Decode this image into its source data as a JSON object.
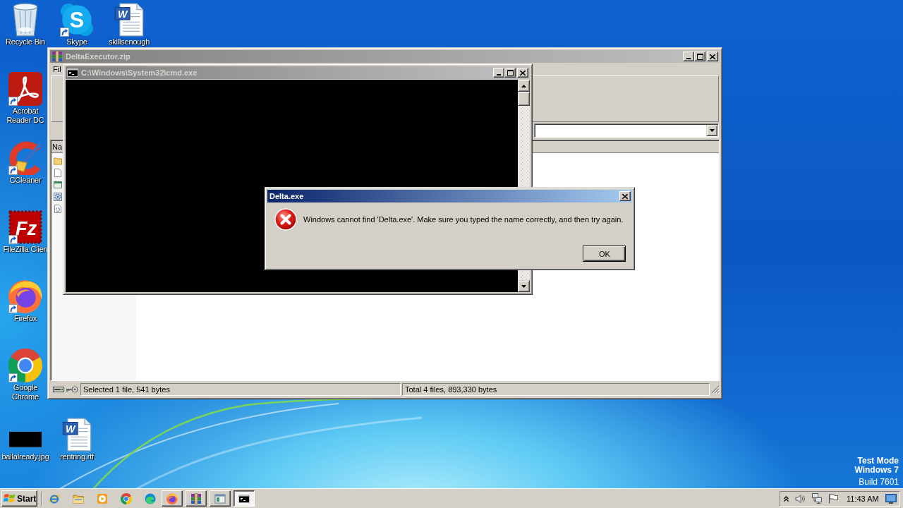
{
  "desktop": {
    "icons": [
      {
        "kind": "recycle-bin",
        "label": "Recycle Bin",
        "shortcut": false
      },
      {
        "kind": "skype",
        "label": "Skype",
        "logo_text": "S",
        "shortcut": true
      },
      {
        "kind": "word-document",
        "label": "skillsenough",
        "logo_text": "W",
        "shortcut": false
      },
      {
        "kind": "acrobat",
        "label": "Acrobat Reader DC",
        "shortcut": true
      },
      {
        "kind": "ccleaner",
        "label": "CCleaner",
        "shortcut": true
      },
      {
        "kind": "filezilla",
        "label": "FileZilla Clien",
        "logo_text": "Fz",
        "shortcut": true
      },
      {
        "kind": "firefox",
        "label": "Firefox",
        "shortcut": true
      },
      {
        "kind": "chrome",
        "label": "Google Chrome",
        "shortcut": true
      },
      {
        "kind": "image",
        "label": "ballalready.jpg",
        "shortcut": false
      },
      {
        "kind": "word-document",
        "label": "rentring.rtf",
        "logo_text": "W",
        "shortcut": false
      }
    ]
  },
  "system_notice": {
    "mode": "Test Mode",
    "edition": "Windows 7",
    "build": "Build 7601"
  },
  "winrar_window": {
    "title": "DeltaExecutor.zip",
    "active": false,
    "menu": [
      "Fil"
    ],
    "column_header": "Na",
    "file_rows": [
      {
        "kind": "folder"
      },
      {
        "kind": "document"
      },
      {
        "kind": "application"
      },
      {
        "kind": "settings"
      },
      {
        "kind": "config"
      }
    ],
    "status_bar": {
      "selection": "Selected 1 file, 541 bytes",
      "total": "Total 4 files, 893,330 bytes"
    }
  },
  "cmd_window": {
    "title": "C:\\Windows\\System32\\cmd.exe",
    "active": false
  },
  "dialog": {
    "title": "Delta.exe",
    "active": true,
    "message": "Windows cannot find 'Delta.exe'. Make sure you typed the name correctly, and then try again.",
    "buttons": [
      "OK"
    ]
  },
  "taskbar": {
    "start": "Start",
    "quick_launch": [
      {
        "kind": "internet-explorer"
      },
      {
        "kind": "explorer"
      },
      {
        "kind": "media-player"
      },
      {
        "kind": "chrome"
      },
      {
        "kind": "edge"
      }
    ],
    "tasks": [
      {
        "kind": "firefox",
        "selected": false
      },
      {
        "kind": "winrar",
        "selected": false
      },
      {
        "kind": "window",
        "selected": false
      },
      {
        "kind": "console",
        "selected": true
      }
    ],
    "tray": {
      "clock": "11:43 AM"
    }
  }
}
